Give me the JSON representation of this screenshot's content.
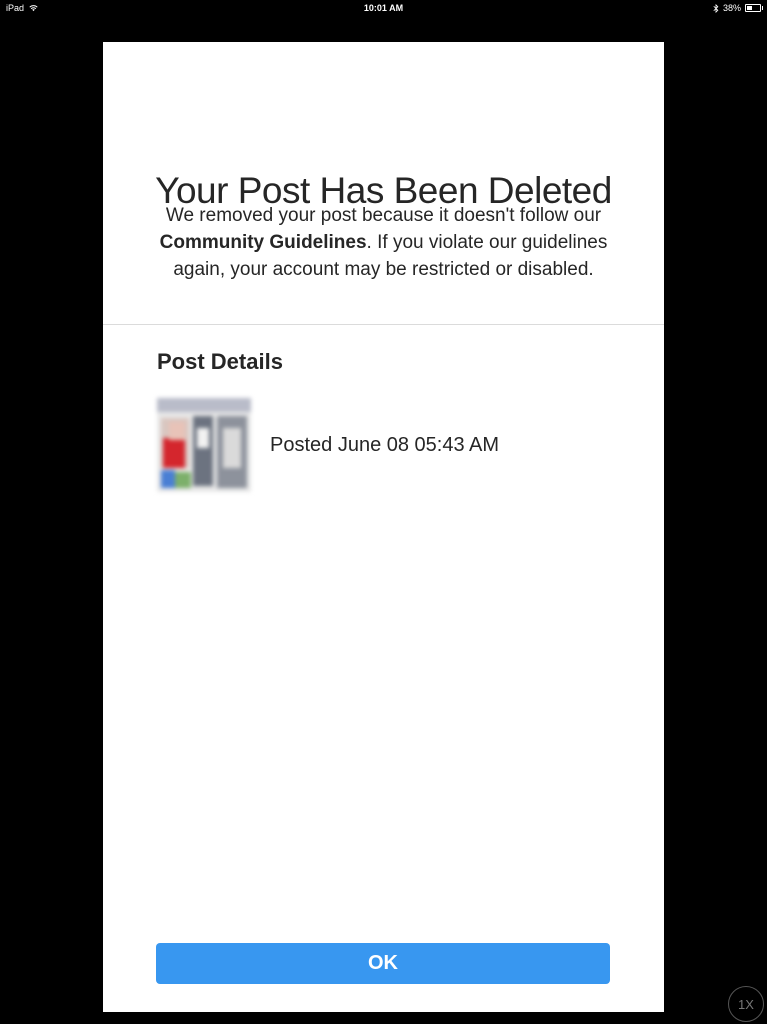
{
  "status_bar": {
    "device": "iPad",
    "time": "10:01 AM",
    "battery": "38%",
    "battery_level": 0.38,
    "icons": [
      "wifi-icon",
      "bluetooth-icon",
      "battery-icon"
    ]
  },
  "modal": {
    "title": "Your Post Has Been Deleted",
    "description": {
      "before": "We removed your post because it doesn't follow our ",
      "link": "Community Guidelines",
      "after": ". If you violate our guidelines again, your account may be restricted or disabled."
    },
    "section_title": "Post Details",
    "post": {
      "thumbnail": "blurred-post-image",
      "date": "Posted June 08 05:43 AM"
    },
    "ok_label": "OK"
  },
  "zoom_badge": "1X",
  "colors": {
    "button": "#3897f0",
    "text": "#262626",
    "divider": "#dbdbdb",
    "background": "#000000"
  }
}
